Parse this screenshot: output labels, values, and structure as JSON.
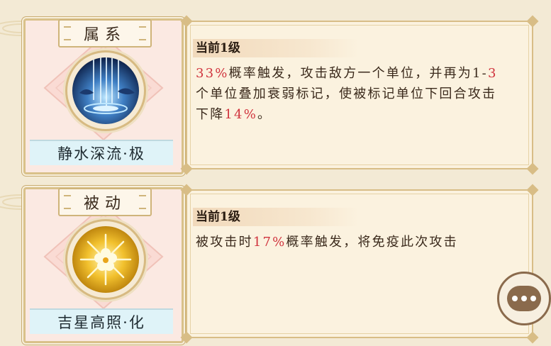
{
  "skills": [
    {
      "type_label": "属系",
      "name": "静水深流·极",
      "icon": "waterfall-emblem-icon",
      "level": "当前1级",
      "desc": [
        {
          "t": "33%",
          "hl": true
        },
        {
          "t": "概率触发，攻击敌方一个单位，并再为1-",
          "hl": false
        },
        {
          "t": "3",
          "hl": true
        },
        {
          "t": "个单位叠加衰弱标记，使被标记单位下回合攻击下降",
          "hl": false
        },
        {
          "t": "14%",
          "hl": true
        },
        {
          "t": "。",
          "hl": false
        }
      ]
    },
    {
      "type_label": "被动",
      "name": "吉星高照·化",
      "icon": "golden-flower-emblem-icon",
      "level": "当前1级",
      "desc": [
        {
          "t": "被攻击时",
          "hl": false
        },
        {
          "t": "17%",
          "hl": true
        },
        {
          "t": "概率触发，将免疫此次攻击",
          "hl": false
        }
      ]
    }
  ],
  "chat_button": {
    "icon": "chat-bubble-icon"
  },
  "colors": {
    "highlight": "#d0333d",
    "frame": "#d8bd86",
    "name_bar": "#dff3f8"
  }
}
